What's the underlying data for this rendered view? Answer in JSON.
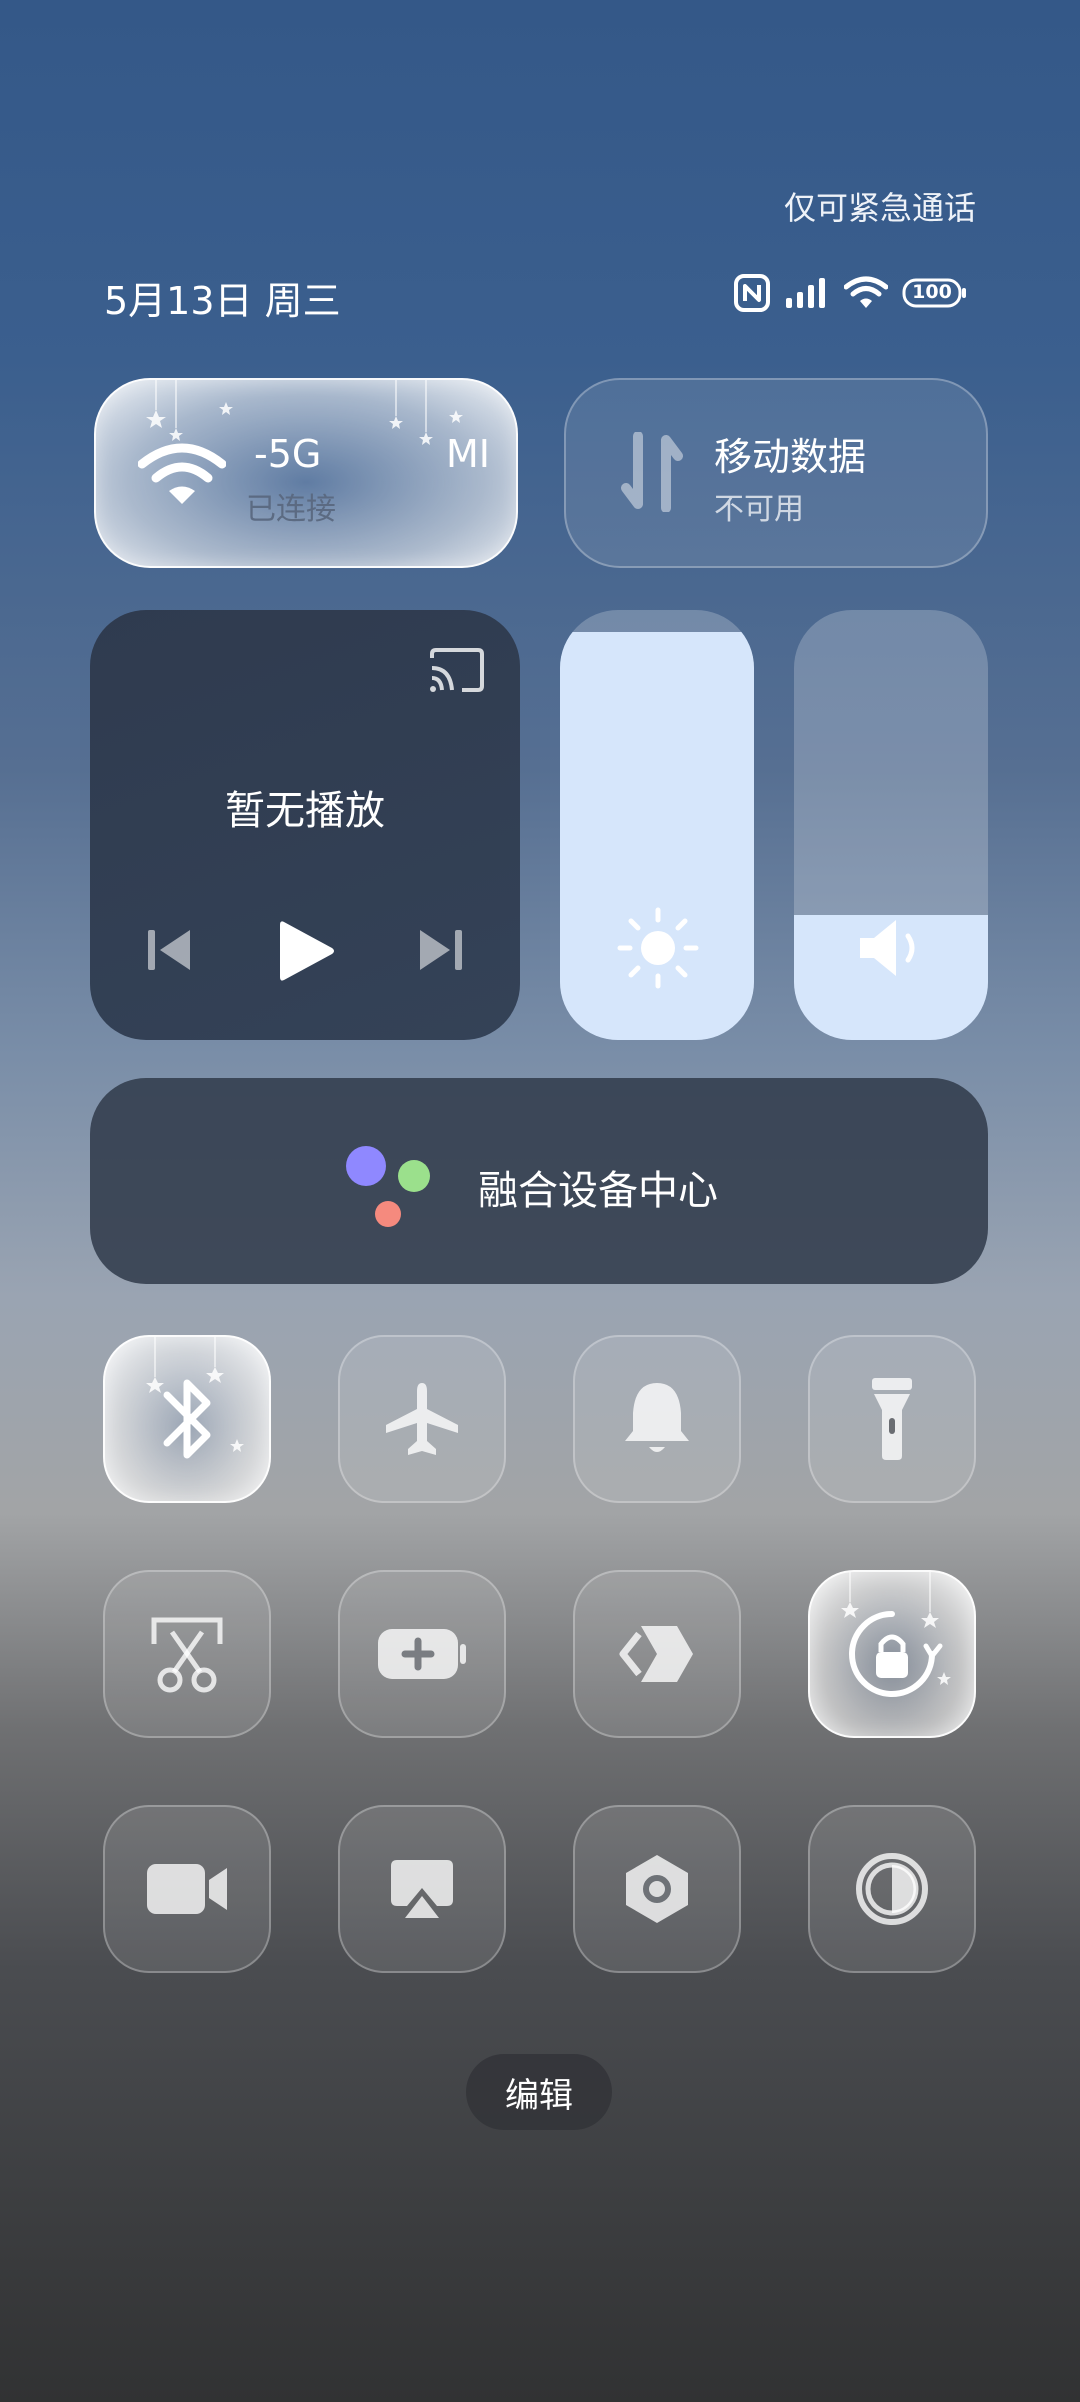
{
  "status": {
    "emergency_text": "仅可紧急通话",
    "date_text": "5月13日 周三",
    "battery": "100",
    "icons": [
      "nfc-icon",
      "signal-icon",
      "wifi-status-icon",
      "battery-icon"
    ]
  },
  "network": {
    "wifi": {
      "ssid_left": "-5G",
      "ssid_right": "MI",
      "state": "已连接",
      "icon": "wifi-icon"
    },
    "mobile": {
      "title": "移动数据",
      "state": "不可用",
      "icon": "data-arrows-icon"
    }
  },
  "media": {
    "title": "暂无播放",
    "icons": [
      "cast-icon",
      "previous-icon",
      "play-icon",
      "next-icon"
    ]
  },
  "sliders": {
    "brightness_level": 0.95,
    "volume_level": 0.29
  },
  "device_center": {
    "label": "融合设备中心",
    "colors": [
      "#8f88ff",
      "#9be08c",
      "#f58a7e"
    ]
  },
  "toggles": [
    {
      "icon": "bluetooth-icon",
      "active": true
    },
    {
      "icon": "airplane-icon",
      "active": false
    },
    {
      "icon": "bell-icon",
      "active": false
    },
    {
      "icon": "flashlight-icon",
      "active": false
    },
    {
      "icon": "screenshot-scissors-icon",
      "active": false
    },
    {
      "icon": "battery-saver-icon",
      "active": false
    },
    {
      "icon": "code-link-icon",
      "active": false
    },
    {
      "icon": "rotation-lock-icon",
      "active": true
    },
    {
      "icon": "video-icon",
      "active": false
    },
    {
      "icon": "screen-cast-icon",
      "active": false
    },
    {
      "icon": "hexagon-settings-icon",
      "active": false
    },
    {
      "icon": "dark-mode-icon",
      "active": false
    }
  ],
  "edit_label": "编辑",
  "colors": {
    "accent_light": "#d6e6fb",
    "media_bg": "#323f54"
  }
}
